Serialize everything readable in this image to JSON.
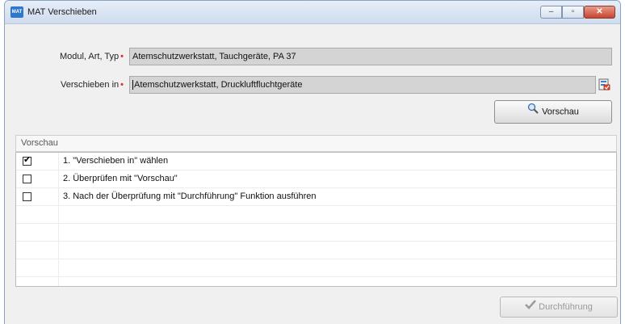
{
  "window": {
    "title": "MAT Verschieben",
    "app_icon_text": "MAT"
  },
  "form": {
    "modul_label": "Modul, Art, Typ",
    "modul_value": "Atemschutzwerkstatt, Tauchgeräte, PA 37",
    "verschieben_label": "Verschieben in",
    "verschieben_value": "Atemschutzwerkstatt, Druckluftfluchtgeräte",
    "required_marker": "•",
    "preview_button_label": "Vorschau"
  },
  "preview": {
    "section_title": "Vorschau",
    "rows": [
      {
        "checked": true,
        "text": "1. \"Verschieben in\" wählen"
      },
      {
        "checked": false,
        "text": "2. Überprüfen mit \"Vorschau\""
      },
      {
        "checked": false,
        "text": "3. Nach der Überprüfung mit \"Durchführung\" Funktion ausführen"
      },
      {
        "checked": null,
        "text": ""
      },
      {
        "checked": null,
        "text": ""
      },
      {
        "checked": null,
        "text": ""
      },
      {
        "checked": null,
        "text": ""
      }
    ]
  },
  "footer": {
    "execute_button_label": "Durchführung"
  },
  "icons": {
    "search": "magnifier-icon",
    "picker": "picker-icon",
    "execute": "check-icon"
  },
  "colors": {
    "title_bg": "#cfdced",
    "close_button": "#c6452f",
    "required": "#e03030",
    "disabled_text": "#9a9a9a"
  }
}
